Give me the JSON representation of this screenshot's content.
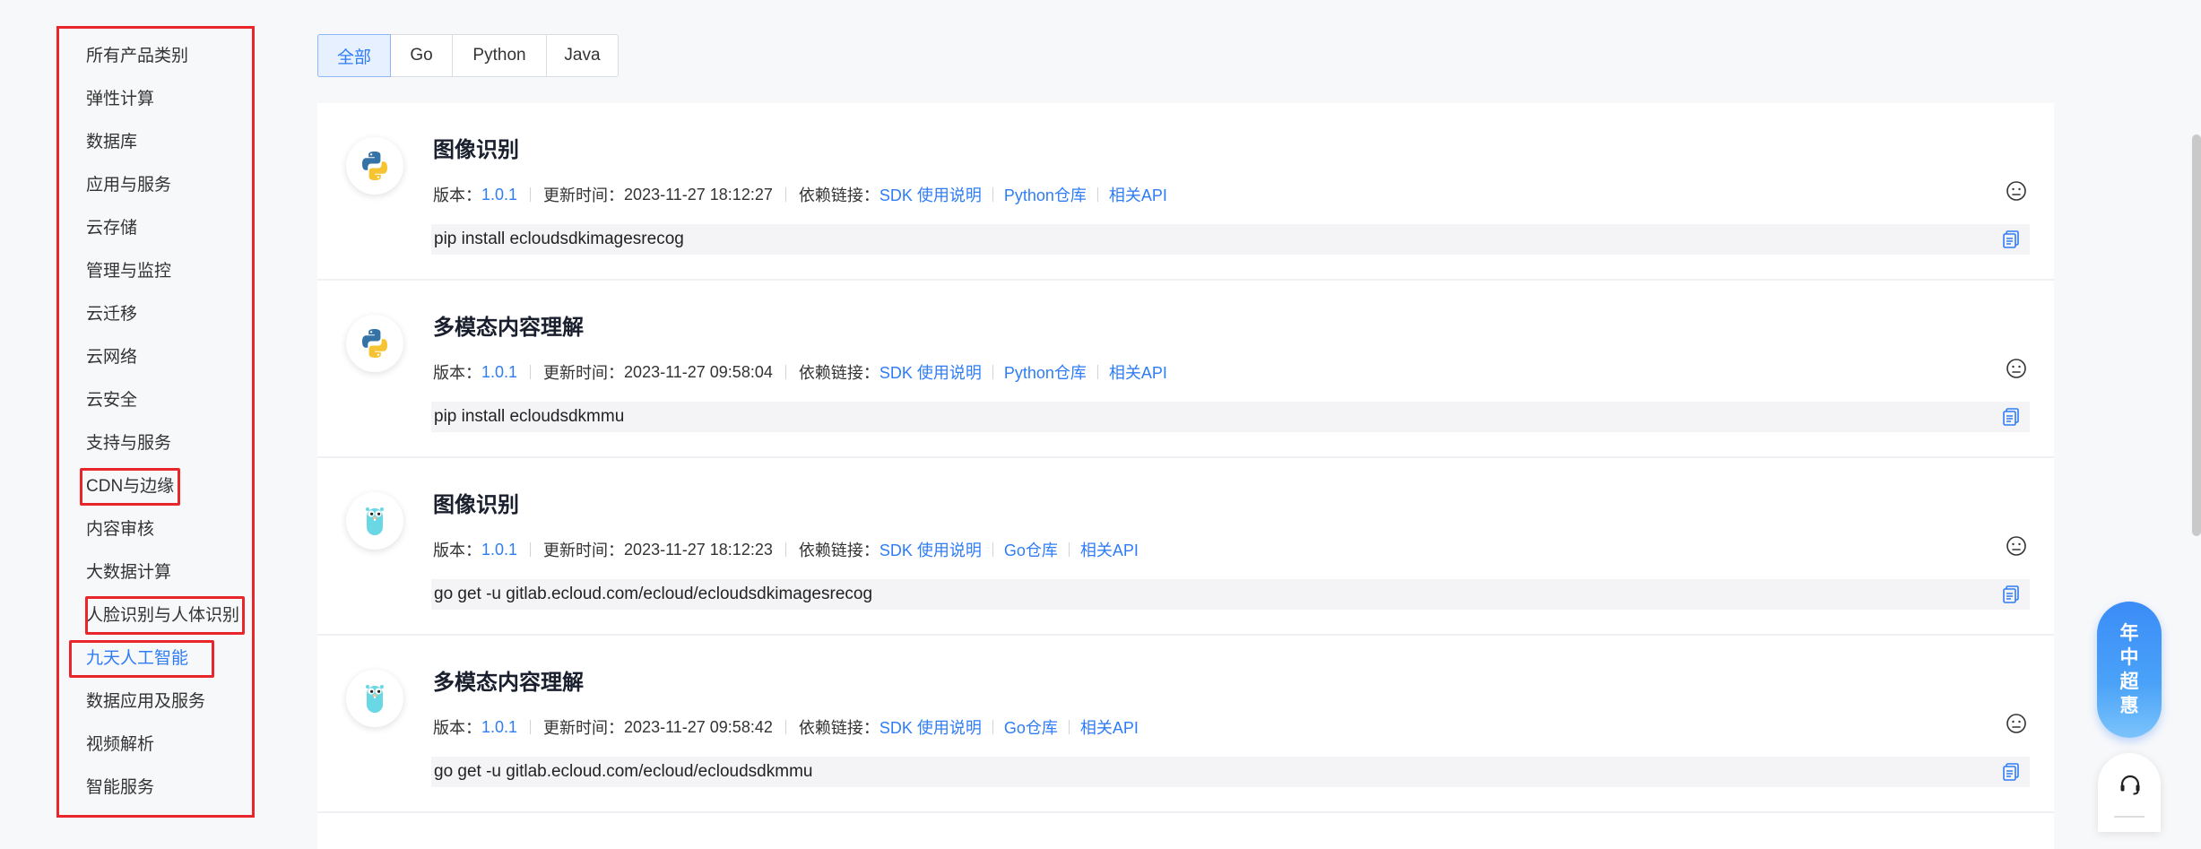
{
  "sidebar": {
    "items": [
      {
        "label": "所有产品类别"
      },
      {
        "label": "弹性计算"
      },
      {
        "label": "数据库"
      },
      {
        "label": "应用与服务"
      },
      {
        "label": "云存储"
      },
      {
        "label": "管理与监控"
      },
      {
        "label": "云迁移"
      },
      {
        "label": "云网络"
      },
      {
        "label": "云安全"
      },
      {
        "label": "支持与服务"
      },
      {
        "label": "CDN与边缘"
      },
      {
        "label": "内容审核"
      },
      {
        "label": "大数据计算"
      },
      {
        "label": "人脸识别与人体识别"
      },
      {
        "label": "九天人工智能"
      },
      {
        "label": "数据应用及服务"
      },
      {
        "label": "视频解析"
      },
      {
        "label": "智能服务"
      }
    ],
    "active_label": "九天人工智能"
  },
  "tabs": [
    {
      "label": "全部"
    },
    {
      "label": "Go"
    },
    {
      "label": "Python"
    },
    {
      "label": "Java"
    }
  ],
  "labels": {
    "version": "版本：",
    "updated": "更新时间：",
    "deps": "依赖链接：",
    "sdk_doc": "SDK 使用说明",
    "related_api": "相关API"
  },
  "cards": [
    {
      "logo": "python-logo",
      "title": "图像识别",
      "version": "1.0.1",
      "updated": "2023-11-27 18:12:27",
      "repo": "Python仓库",
      "command": "pip install ecloudsdkimagesrecog"
    },
    {
      "logo": "python-logo",
      "title": "多模态内容理解",
      "version": "1.0.1",
      "updated": "2023-11-27 09:58:04",
      "repo": "Python仓库",
      "command": "pip install ecloudsdkmmu"
    },
    {
      "logo": "go-gopher-logo",
      "title": "图像识别",
      "version": "1.0.1",
      "updated": "2023-11-27 18:12:23",
      "repo": "Go仓库",
      "command": "go get -u gitlab.ecloud.com/ecloud/ecloudsdkimagesrecog"
    },
    {
      "logo": "go-gopher-logo",
      "title": "多模态内容理解",
      "version": "1.0.1",
      "updated": "2023-11-27 09:58:42",
      "repo": "Go仓库",
      "command": "go get -u gitlab.ecloud.com/ecloud/ecloudsdkmmu"
    }
  ],
  "promo": {
    "chars": [
      "年",
      "中",
      "超",
      "惠"
    ]
  },
  "colors": {
    "accent": "#2f7df6",
    "highlight": "#e8262c",
    "background": "#f7f8fa"
  }
}
